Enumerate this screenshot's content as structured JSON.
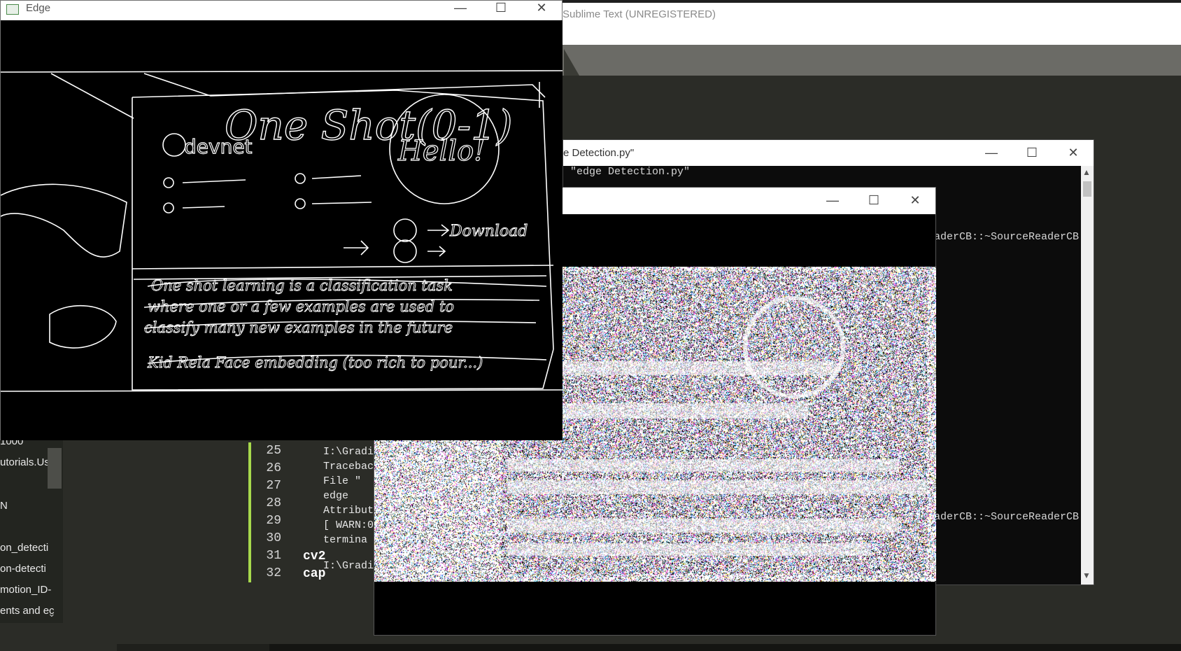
{
  "sublime": {
    "title": "Sublime Text (UNREGISTERED)",
    "sidebar_items": [
      "1000",
      "utorials.Us",
      "N",
      "on_detecti",
      "on-detecti",
      "motion_ID-",
      "ents and ec"
    ],
    "line_numbers": [
      "25",
      "26",
      "27",
      "28",
      "29",
      "30",
      "31",
      "32"
    ],
    "output_lines": [
      "I:\\Gradi",
      "Tracebac",
      "  File \"",
      "    edge",
      "Attribut",
      "[ WARN:0",
      " termina",
      "",
      "I:\\Gradi"
    ],
    "code_lines": [
      "cv2",
      "cap"
    ]
  },
  "terminal": {
    "title": "e Detection.py\"",
    "lines": [
      "\"edge Detection.py\"",
      "aderCB::~SourceReaderCB",
      "aderCB::~SourceReaderCB"
    ],
    "minimize": "—",
    "maximize": "☐",
    "close": "✕"
  },
  "noise_window": {
    "minimize": "—",
    "maximize": "☐",
    "close": "✕"
  },
  "edge_window": {
    "title": "Edge",
    "minimize": "—",
    "maximize": "☐",
    "close": "✕",
    "board_text": [
      "One Shot(0-1)",
      "devnet",
      "Hello!",
      "Download"
    ],
    "handwriting_lines": [
      "One shot learning is a classification task",
      "where one or a few examples are used to",
      "classify many new examples in the future",
      "Kid Rela Face embedding (too rich to pour...)"
    ]
  }
}
